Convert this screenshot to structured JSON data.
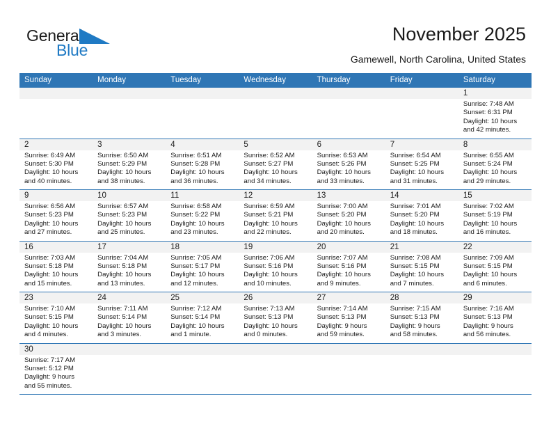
{
  "brand": {
    "name_top": "General",
    "name_bottom": "Blue",
    "accent_color": "#1f7ac4",
    "triangle_icon": "blue-triangle-logo-mark"
  },
  "header": {
    "title": "November 2025",
    "subtitle": "Gamewell, North Carolina, United States"
  },
  "calendar": {
    "header_bg": "#2f76b5",
    "header_text_color": "#ffffff",
    "daynum_band_bg": "#f2f2f2",
    "weekday_headers": [
      "Sunday",
      "Monday",
      "Tuesday",
      "Wednesday",
      "Thursday",
      "Friday",
      "Saturday"
    ],
    "weeks": [
      [
        {
          "day": "",
          "sunrise": "",
          "sunset": "",
          "daylight1": "",
          "daylight2": ""
        },
        {
          "day": "",
          "sunrise": "",
          "sunset": "",
          "daylight1": "",
          "daylight2": ""
        },
        {
          "day": "",
          "sunrise": "",
          "sunset": "",
          "daylight1": "",
          "daylight2": ""
        },
        {
          "day": "",
          "sunrise": "",
          "sunset": "",
          "daylight1": "",
          "daylight2": ""
        },
        {
          "day": "",
          "sunrise": "",
          "sunset": "",
          "daylight1": "",
          "daylight2": ""
        },
        {
          "day": "",
          "sunrise": "",
          "sunset": "",
          "daylight1": "",
          "daylight2": ""
        },
        {
          "day": "1",
          "sunrise": "Sunrise: 7:48 AM",
          "sunset": "Sunset: 6:31 PM",
          "daylight1": "Daylight: 10 hours",
          "daylight2": "and 42 minutes."
        }
      ],
      [
        {
          "day": "2",
          "sunrise": "Sunrise: 6:49 AM",
          "sunset": "Sunset: 5:30 PM",
          "daylight1": "Daylight: 10 hours",
          "daylight2": "and 40 minutes."
        },
        {
          "day": "3",
          "sunrise": "Sunrise: 6:50 AM",
          "sunset": "Sunset: 5:29 PM",
          "daylight1": "Daylight: 10 hours",
          "daylight2": "and 38 minutes."
        },
        {
          "day": "4",
          "sunrise": "Sunrise: 6:51 AM",
          "sunset": "Sunset: 5:28 PM",
          "daylight1": "Daylight: 10 hours",
          "daylight2": "and 36 minutes."
        },
        {
          "day": "5",
          "sunrise": "Sunrise: 6:52 AM",
          "sunset": "Sunset: 5:27 PM",
          "daylight1": "Daylight: 10 hours",
          "daylight2": "and 34 minutes."
        },
        {
          "day": "6",
          "sunrise": "Sunrise: 6:53 AM",
          "sunset": "Sunset: 5:26 PM",
          "daylight1": "Daylight: 10 hours",
          "daylight2": "and 33 minutes."
        },
        {
          "day": "7",
          "sunrise": "Sunrise: 6:54 AM",
          "sunset": "Sunset: 5:25 PM",
          "daylight1": "Daylight: 10 hours",
          "daylight2": "and 31 minutes."
        },
        {
          "day": "8",
          "sunrise": "Sunrise: 6:55 AM",
          "sunset": "Sunset: 5:24 PM",
          "daylight1": "Daylight: 10 hours",
          "daylight2": "and 29 minutes."
        }
      ],
      [
        {
          "day": "9",
          "sunrise": "Sunrise: 6:56 AM",
          "sunset": "Sunset: 5:23 PM",
          "daylight1": "Daylight: 10 hours",
          "daylight2": "and 27 minutes."
        },
        {
          "day": "10",
          "sunrise": "Sunrise: 6:57 AM",
          "sunset": "Sunset: 5:23 PM",
          "daylight1": "Daylight: 10 hours",
          "daylight2": "and 25 minutes."
        },
        {
          "day": "11",
          "sunrise": "Sunrise: 6:58 AM",
          "sunset": "Sunset: 5:22 PM",
          "daylight1": "Daylight: 10 hours",
          "daylight2": "and 23 minutes."
        },
        {
          "day": "12",
          "sunrise": "Sunrise: 6:59 AM",
          "sunset": "Sunset: 5:21 PM",
          "daylight1": "Daylight: 10 hours",
          "daylight2": "and 22 minutes."
        },
        {
          "day": "13",
          "sunrise": "Sunrise: 7:00 AM",
          "sunset": "Sunset: 5:20 PM",
          "daylight1": "Daylight: 10 hours",
          "daylight2": "and 20 minutes."
        },
        {
          "day": "14",
          "sunrise": "Sunrise: 7:01 AM",
          "sunset": "Sunset: 5:20 PM",
          "daylight1": "Daylight: 10 hours",
          "daylight2": "and 18 minutes."
        },
        {
          "day": "15",
          "sunrise": "Sunrise: 7:02 AM",
          "sunset": "Sunset: 5:19 PM",
          "daylight1": "Daylight: 10 hours",
          "daylight2": "and 16 minutes."
        }
      ],
      [
        {
          "day": "16",
          "sunrise": "Sunrise: 7:03 AM",
          "sunset": "Sunset: 5:18 PM",
          "daylight1": "Daylight: 10 hours",
          "daylight2": "and 15 minutes."
        },
        {
          "day": "17",
          "sunrise": "Sunrise: 7:04 AM",
          "sunset": "Sunset: 5:18 PM",
          "daylight1": "Daylight: 10 hours",
          "daylight2": "and 13 minutes."
        },
        {
          "day": "18",
          "sunrise": "Sunrise: 7:05 AM",
          "sunset": "Sunset: 5:17 PM",
          "daylight1": "Daylight: 10 hours",
          "daylight2": "and 12 minutes."
        },
        {
          "day": "19",
          "sunrise": "Sunrise: 7:06 AM",
          "sunset": "Sunset: 5:16 PM",
          "daylight1": "Daylight: 10 hours",
          "daylight2": "and 10 minutes."
        },
        {
          "day": "20",
          "sunrise": "Sunrise: 7:07 AM",
          "sunset": "Sunset: 5:16 PM",
          "daylight1": "Daylight: 10 hours",
          "daylight2": "and 9 minutes."
        },
        {
          "day": "21",
          "sunrise": "Sunrise: 7:08 AM",
          "sunset": "Sunset: 5:15 PM",
          "daylight1": "Daylight: 10 hours",
          "daylight2": "and 7 minutes."
        },
        {
          "day": "22",
          "sunrise": "Sunrise: 7:09 AM",
          "sunset": "Sunset: 5:15 PM",
          "daylight1": "Daylight: 10 hours",
          "daylight2": "and 6 minutes."
        }
      ],
      [
        {
          "day": "23",
          "sunrise": "Sunrise: 7:10 AM",
          "sunset": "Sunset: 5:15 PM",
          "daylight1": "Daylight: 10 hours",
          "daylight2": "and 4 minutes."
        },
        {
          "day": "24",
          "sunrise": "Sunrise: 7:11 AM",
          "sunset": "Sunset: 5:14 PM",
          "daylight1": "Daylight: 10 hours",
          "daylight2": "and 3 minutes."
        },
        {
          "day": "25",
          "sunrise": "Sunrise: 7:12 AM",
          "sunset": "Sunset: 5:14 PM",
          "daylight1": "Daylight: 10 hours",
          "daylight2": "and 1 minute."
        },
        {
          "day": "26",
          "sunrise": "Sunrise: 7:13 AM",
          "sunset": "Sunset: 5:13 PM",
          "daylight1": "Daylight: 10 hours",
          "daylight2": "and 0 minutes."
        },
        {
          "day": "27",
          "sunrise": "Sunrise: 7:14 AM",
          "sunset": "Sunset: 5:13 PM",
          "daylight1": "Daylight: 9 hours",
          "daylight2": "and 59 minutes."
        },
        {
          "day": "28",
          "sunrise": "Sunrise: 7:15 AM",
          "sunset": "Sunset: 5:13 PM",
          "daylight1": "Daylight: 9 hours",
          "daylight2": "and 58 minutes."
        },
        {
          "day": "29",
          "sunrise": "Sunrise: 7:16 AM",
          "sunset": "Sunset: 5:13 PM",
          "daylight1": "Daylight: 9 hours",
          "daylight2": "and 56 minutes."
        }
      ],
      [
        {
          "day": "30",
          "sunrise": "Sunrise: 7:17 AM",
          "sunset": "Sunset: 5:12 PM",
          "daylight1": "Daylight: 9 hours",
          "daylight2": "and 55 minutes."
        },
        {
          "day": "",
          "sunrise": "",
          "sunset": "",
          "daylight1": "",
          "daylight2": ""
        },
        {
          "day": "",
          "sunrise": "",
          "sunset": "",
          "daylight1": "",
          "daylight2": ""
        },
        {
          "day": "",
          "sunrise": "",
          "sunset": "",
          "daylight1": "",
          "daylight2": ""
        },
        {
          "day": "",
          "sunrise": "",
          "sunset": "",
          "daylight1": "",
          "daylight2": ""
        },
        {
          "day": "",
          "sunrise": "",
          "sunset": "",
          "daylight1": "",
          "daylight2": ""
        },
        {
          "day": "",
          "sunrise": "",
          "sunset": "",
          "daylight1": "",
          "daylight2": ""
        }
      ]
    ]
  }
}
